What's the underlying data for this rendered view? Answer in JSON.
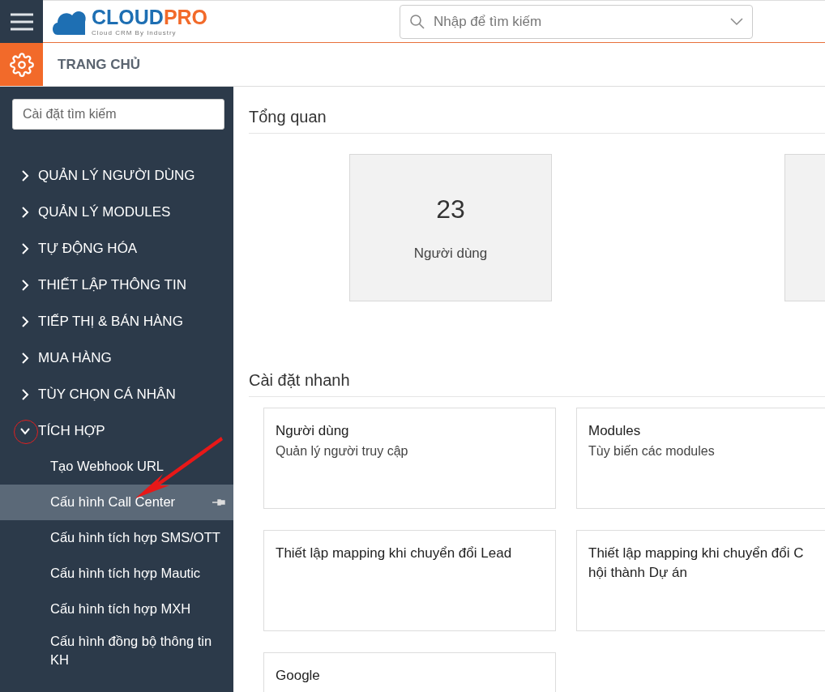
{
  "header": {
    "logo": {
      "main": "CLOUD",
      "accent": "PRO",
      "tagline": "Cloud CRM By Industry"
    },
    "search": {
      "placeholder": "Nhập để tìm kiếm"
    }
  },
  "subbar": {
    "title": "TRANG CHỦ"
  },
  "sidebar": {
    "search": {
      "placeholder": "Cài đặt tìm kiếm"
    },
    "items": [
      {
        "label": "QUẢN LÝ NGƯỜI DÙNG",
        "expanded": false
      },
      {
        "label": "QUẢN LÝ MODULES",
        "expanded": false
      },
      {
        "label": "TỰ ĐỘNG HÓA",
        "expanded": false
      },
      {
        "label": "THIẾT LẬP THÔNG TIN",
        "expanded": false
      },
      {
        "label": "TIẾP THỊ & BÁN HÀNG",
        "expanded": false
      },
      {
        "label": "MUA HÀNG",
        "expanded": false
      },
      {
        "label": "TÙY CHỌN CÁ NHÂN",
        "expanded": false
      },
      {
        "label": "TÍCH HỢP",
        "expanded": true,
        "annotated": true,
        "children": [
          {
            "label": "Tạo Webhook URL",
            "selected": false
          },
          {
            "label": "Cấu hình Call Center",
            "selected": true
          },
          {
            "label": "Cấu hình tích hợp SMS/OTT",
            "selected": false
          },
          {
            "label": "Cấu hình tích hợp Mautic",
            "selected": false
          },
          {
            "label": "Cấu hình tích hợp MXH",
            "selected": false
          },
          {
            "label": "Cấu hình đồng bộ thông tin KH",
            "selected": false
          }
        ]
      }
    ]
  },
  "overview": {
    "title": "Tổng quan",
    "stats": [
      {
        "value": "23",
        "label": "Người dùng"
      }
    ]
  },
  "quick": {
    "title": "Cài đặt nhanh",
    "cards": [
      {
        "title": "Người dùng",
        "description": "Quản lý người truy cập"
      },
      {
        "title": "Modules",
        "description": "Tùy biến các modules"
      },
      {
        "title": "Thiết lập mapping khi chuyển đổi Lead"
      },
      {
        "title": "Thiết lập mapping khi chuyển đổi C hội thành Dự án"
      },
      {
        "title": "Google"
      }
    ]
  }
}
